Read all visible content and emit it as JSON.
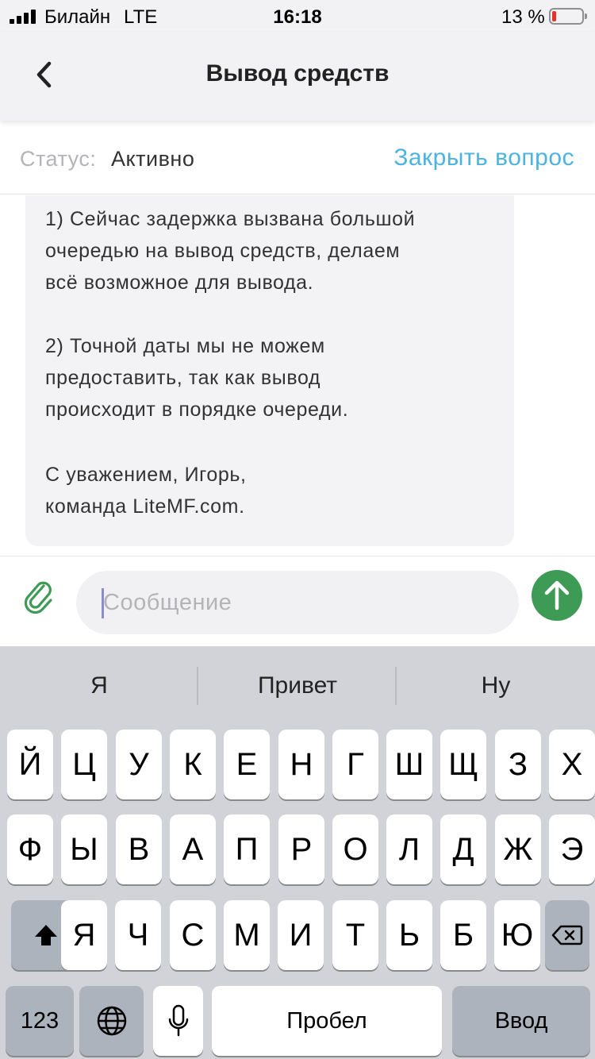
{
  "status_bar": {
    "carrier": "Билайн",
    "network": "LTE",
    "time": "16:18",
    "battery_percent": "13 %",
    "battery_level": 0.13
  },
  "nav": {
    "title": "Вывод средств",
    "back_icon": "chevron-left-icon"
  },
  "ticket": {
    "status_label": "Статус:",
    "status_value": "Активно",
    "close_label": "Закрыть вопрос"
  },
  "message": {
    "paragraphs": [
      [
        "1) Сейчас задержка вызвана большой",
        "очередью на вывод средств, делаем",
        "всё возможное для вывода."
      ],
      [
        "2) Точной даты мы не можем",
        "предоставить, так как вывод",
        "происходит в порядке очереди."
      ],
      [
        "С уважением, Игорь,",
        "команда LiteMF.com."
      ]
    ]
  },
  "composer": {
    "placeholder": "Сообщение",
    "attach_icon": "paperclip-icon",
    "send_icon": "arrow-up-icon"
  },
  "keyboard": {
    "suggestions": [
      "Я",
      "Привет",
      "Ну"
    ],
    "rows": [
      [
        "Й",
        "Ц",
        "У",
        "К",
        "Е",
        "Н",
        "Г",
        "Ш",
        "Щ",
        "З",
        "Х"
      ],
      [
        "Ф",
        "Ы",
        "В",
        "А",
        "П",
        "Р",
        "О",
        "Л",
        "Д",
        "Ж",
        "Э"
      ],
      [
        "Я",
        "Ч",
        "С",
        "М",
        "И",
        "Т",
        "Ь",
        "Б",
        "Ю"
      ]
    ],
    "numbers_label": "123",
    "space_label": "Пробел",
    "return_label": "Ввод",
    "shift_icon": "shift-icon",
    "delete_icon": "backspace-icon",
    "globe_icon": "globe-icon",
    "mic_icon": "microphone-icon"
  },
  "colors": {
    "accent_link": "#4db3e0",
    "send_button": "#3e9b55",
    "attach_icon": "#3e9b55",
    "battery_low": "#e5332a"
  }
}
